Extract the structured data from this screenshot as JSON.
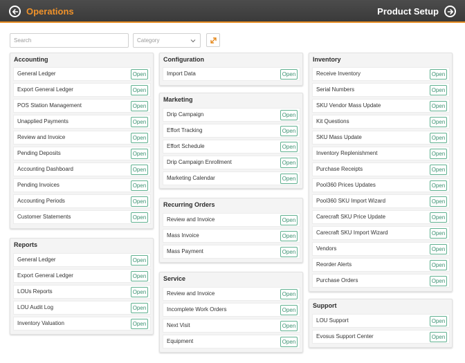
{
  "header": {
    "left_title": "Operations",
    "right_title": "Product Setup",
    "back_icon": "arrow-left-circle-icon",
    "forward_icon": "arrow-right-circle-icon",
    "accent_color": "#e58a1f"
  },
  "toolbar": {
    "search_placeholder": "Search",
    "category_value": "Category",
    "expand_icon": "expand-arrows-icon"
  },
  "button_label": "Open",
  "panels": [
    {
      "title": "Accounting",
      "items": [
        "General Ledger",
        "Export General Ledger",
        "POS Station Management",
        "Unapplied Payments",
        "Review and Invoice",
        "Pending Deposits",
        "Accounting Dashboard",
        "Pending Invoices",
        "Accounting Periods",
        "Customer Statements"
      ]
    },
    {
      "title": "Reports",
      "items": [
        "General Ledger",
        "Export General Ledger",
        "LOUs Reports",
        "LOU Audit Log",
        "Inventory Valuation"
      ]
    },
    {
      "title": "Configuration",
      "items": [
        "Import Data"
      ]
    },
    {
      "title": "Marketing",
      "items": [
        "Drip Campaign",
        "Effort Tracking",
        "Effort Schedule",
        "Drip Campaign Enrollment",
        "Marketing Calendar"
      ]
    },
    {
      "title": "Recurring Orders",
      "items": [
        "Review and Invoice",
        "Mass Invoice",
        "Mass Payment"
      ]
    },
    {
      "title": "Service",
      "items": [
        "Review and Invoice",
        "Incomplete Work Orders",
        "Next Visit",
        "Equipment"
      ]
    },
    {
      "title": "Inventory",
      "items": [
        "Receive Inventory",
        "Serial Numbers",
        "SKU Vendor Mass Update",
        "Kit Questions",
        "SKU Mass Update",
        "Inventory Replenishment",
        "Purchase Receipts",
        "Pool360 Prices Updates",
        "Pool360 SKU Import Wizard",
        "Carecraft SKU Price Update",
        "Carecraft SKU Import Wizard",
        "Vendors",
        "Reorder Alerts",
        "Purchase Orders"
      ]
    },
    {
      "title": "Support",
      "items": [
        "LOU Support",
        "Evosus Support Center"
      ]
    }
  ]
}
